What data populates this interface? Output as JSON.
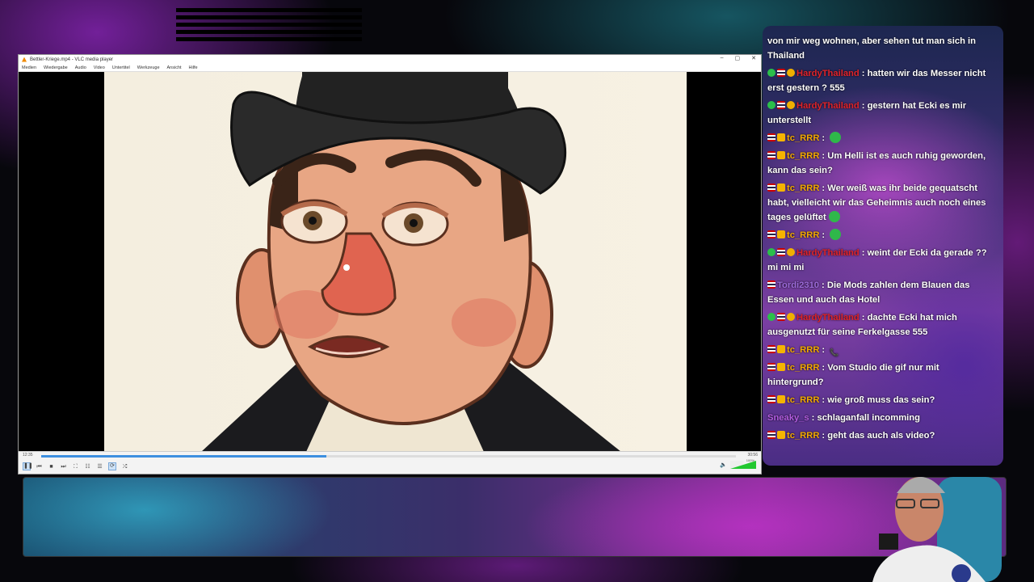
{
  "window": {
    "title": "Bettler-Kriege.mp4 - VLC media player",
    "controls": [
      "–",
      "▢",
      "✕"
    ]
  },
  "menu": [
    "Medien",
    "Wiedergabe",
    "Audio",
    "Video",
    "Untertitel",
    "Werkzeuge",
    "Ansicht",
    "Hilfe"
  ],
  "player": {
    "elapsed": "12:35",
    "total": "30:56",
    "progress_percent": 41,
    "volume_label": "100%"
  },
  "chat": {
    "messages": [
      {
        "user": "",
        "user_color": "",
        "badges": [],
        "text": "von mir weg wohnen, aber sehen tut man sich in Thailand"
      },
      {
        "user": "HardyThailand",
        "user_color": "#e0232a",
        "badges": [
          "check",
          "flag",
          "warn"
        ],
        "text": "hatten wir das Messer nicht erst gestern ? 555"
      },
      {
        "user": "HardyThailand",
        "user_color": "#e0232a",
        "badges": [
          "check",
          "flag",
          "warn"
        ],
        "text": "gestern hat Ecki es mir unterstellt"
      },
      {
        "user": "tc_RRR",
        "user_color": "#f2a900",
        "badges": [
          "flag",
          "crown"
        ],
        "text": "",
        "emote": "green-emote"
      },
      {
        "user": "tc_RRR",
        "user_color": "#f2a900",
        "badges": [
          "flag",
          "crown"
        ],
        "text": "Um Helli ist es auch ruhig geworden, kann das sein?"
      },
      {
        "user": "tc_RRR",
        "user_color": "#f2a900",
        "badges": [
          "flag",
          "crown"
        ],
        "text": "Wer weiß was ihr beide gequatscht habt, vielleicht wir das Geheimnis auch noch eines tages gelüftet",
        "emote": "ghost-green-emote"
      },
      {
        "user": "tc_RRR",
        "user_color": "#f2a900",
        "badges": [
          "flag",
          "crown"
        ],
        "text": "",
        "emote": "green-emote"
      },
      {
        "user": "HardyThailand",
        "user_color": "#e0232a",
        "badges": [
          "check",
          "flag",
          "warn"
        ],
        "text": "weint der Ecki da gerade ?? mi mi mi"
      },
      {
        "user": "Tordi2310",
        "user_color": "#9b6ad8",
        "badges": [
          "flag"
        ],
        "text": "Die Mods zahlen dem Blauen das Essen und auch das Hotel"
      },
      {
        "user": "HardyThailand",
        "user_color": "#e0232a",
        "badges": [
          "check",
          "flag",
          "warn"
        ],
        "text": "dachte Ecki hat mich ausgenutzt für seine Ferkelgasse 555"
      },
      {
        "user": "tc_RRR",
        "user_color": "#f2a900",
        "badges": [
          "flag",
          "crown"
        ],
        "text": "",
        "emote": "phone-emote"
      },
      {
        "user": "tc_RRR",
        "user_color": "#f2a900",
        "badges": [
          "flag",
          "crown"
        ],
        "text": "Vom Studio die gif nur mit hintergrund?"
      },
      {
        "user": "tc_RRR",
        "user_color": "#f2a900",
        "badges": [
          "flag",
          "crown"
        ],
        "text": "wie groß muss das sein?"
      },
      {
        "user": "Sneaky_s",
        "user_color": "#b25ce0",
        "badges": [],
        "text": "schlaganfall incomming"
      },
      {
        "user": "tc_RRR",
        "user_color": "#f2a900",
        "badges": [
          "flag",
          "crown"
        ],
        "text": "geht das auch als video?"
      }
    ]
  }
}
